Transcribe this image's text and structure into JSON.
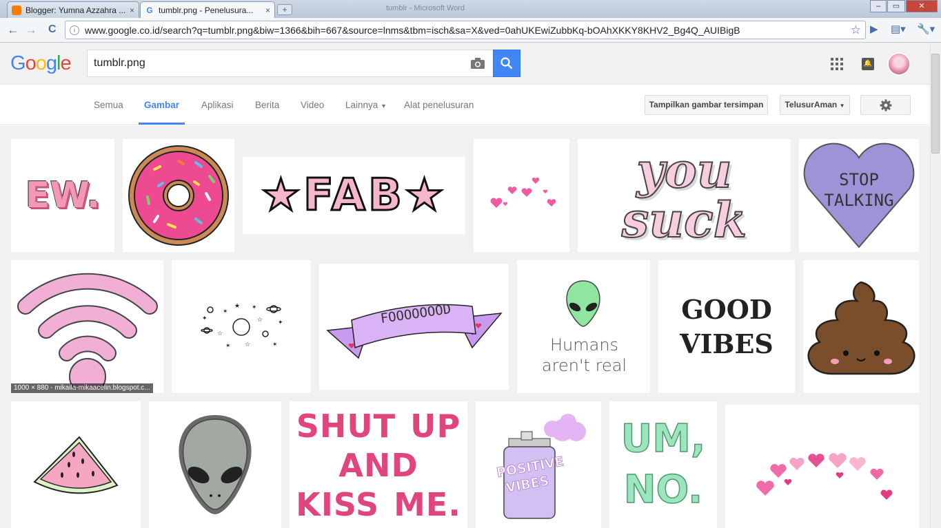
{
  "browser": {
    "tabs": [
      {
        "title": "Blogger: Yumna Azzahra ...",
        "close": "×"
      },
      {
        "title": "tumblr.png - Penelusura...",
        "close": "×"
      }
    ],
    "new_tab": "+",
    "window_title": "tumblr - Microsoft Word",
    "window_buttons": [
      "–",
      "▭",
      "✕"
    ],
    "url": "www.google.co.id/search?q=tumblr.png&biw=1366&bih=667&source=lnms&tbm=isch&sa=X&ved=0ahUKEwiZubbKq-bOAhXKKY8KHV2_Bg4Q_AUIBigB",
    "nav": {
      "back": "←",
      "forward": "→",
      "reload": "C"
    },
    "icons": [
      "star-icon",
      "play-icon",
      "page-icon",
      "wrench-icon"
    ]
  },
  "google": {
    "logo": "Google",
    "query": "tumblr.png",
    "nav_tabs": [
      "Semua",
      "Gambar",
      "Aplikasi",
      "Berita",
      "Video",
      "Lainnya",
      "Alat penelusuran"
    ],
    "active_tab": "Gambar",
    "buttons": {
      "saved": "Tampilkan gambar tersimpan",
      "safesearch": "TelusurAman"
    }
  },
  "results": {
    "row1": [
      "EW.",
      "",
      "★FAB★",
      "",
      "you suck",
      "STOP TALKING"
    ],
    "row2": [
      "",
      "",
      "FOOOOOOOD",
      "Humans aren't real",
      "GOOD VIBES",
      ""
    ],
    "row3": [
      "",
      "",
      "SHUT UP AND KISS ME.",
      "POSITIVE VIBES",
      "UM, NO.",
      ""
    ],
    "meta_caption": "1000 × 880 - mikaila-mikaacelin.blogspot.c..."
  },
  "colors": {
    "accent": "#4285f4",
    "pink": "#f4a7c0",
    "lavender": "#a09bd9"
  }
}
